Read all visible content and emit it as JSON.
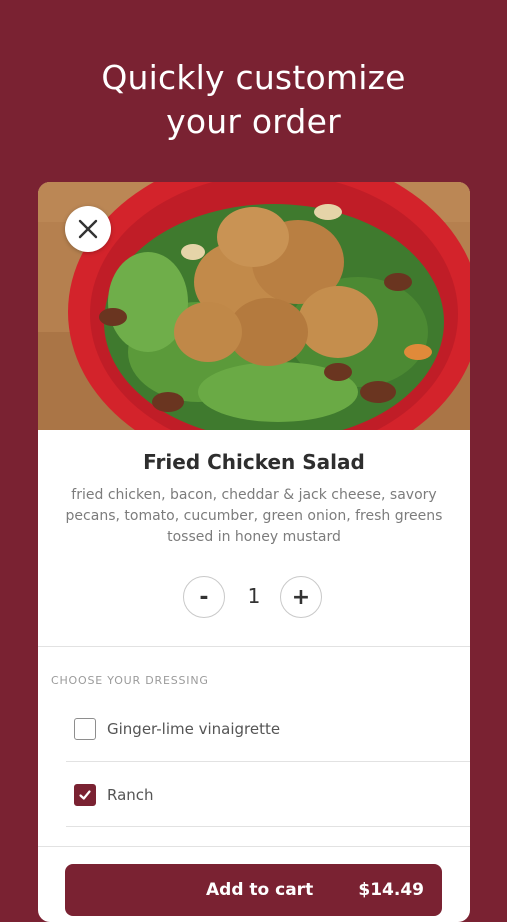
{
  "headline": {
    "line1": "Quickly customize",
    "line2": "your order"
  },
  "item": {
    "name": "Fried Chicken Salad",
    "description": "fried chicken, bacon, cheddar & jack cheese, savory pecans, tomato, cucumber, green onion, fresh greens tossed in honey mustard",
    "image_icon": "salad-photo"
  },
  "quantity": {
    "value": "1",
    "minus_label": "-",
    "plus_label": "+"
  },
  "dressing": {
    "header": "CHOOSE YOUR DRESSING",
    "options": [
      {
        "label": "Ginger-lime vinaigrette",
        "checked": false
      },
      {
        "label": "Ranch",
        "checked": true
      }
    ]
  },
  "cart": {
    "add_label": "Add to cart",
    "price": "$14.49"
  },
  "colors": {
    "brand": "#7a2232",
    "text_dark": "#2e2e2e",
    "text_muted": "#7c7c7c",
    "divider": "#e2e2e2"
  },
  "icons": {
    "close": "close-icon",
    "check": "check-icon"
  }
}
